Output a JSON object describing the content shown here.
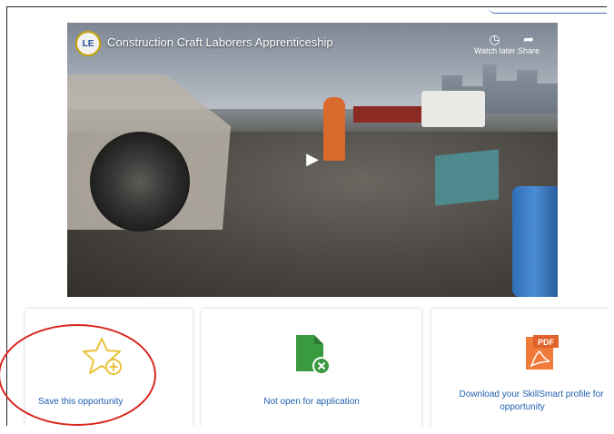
{
  "video": {
    "title": "Construction Craft Laborers Apprenticeship",
    "channel_logo_text": "LE",
    "watch_later_label": "Watch later",
    "share_label": "Share",
    "icons": {
      "watch_later": "clock-icon",
      "share": "share-arrow-icon",
      "play": "play-icon"
    }
  },
  "cards": [
    {
      "label": "Save this opportunity",
      "icon": "star-plus-icon"
    },
    {
      "label": "Not open for application",
      "icon": "document-x-icon"
    },
    {
      "label_line1": "Download your SkillSmart profile for",
      "label_line2": "opportunity",
      "icon": "pdf-icon",
      "pdf_text": "PDF"
    }
  ],
  "colors": {
    "link_blue": "#1f5fae",
    "star_yellow": "#e9c23a",
    "doc_green": "#3a9a3f",
    "pdf_orange": "#f07a3a",
    "annotation_red": "#d9281f"
  }
}
